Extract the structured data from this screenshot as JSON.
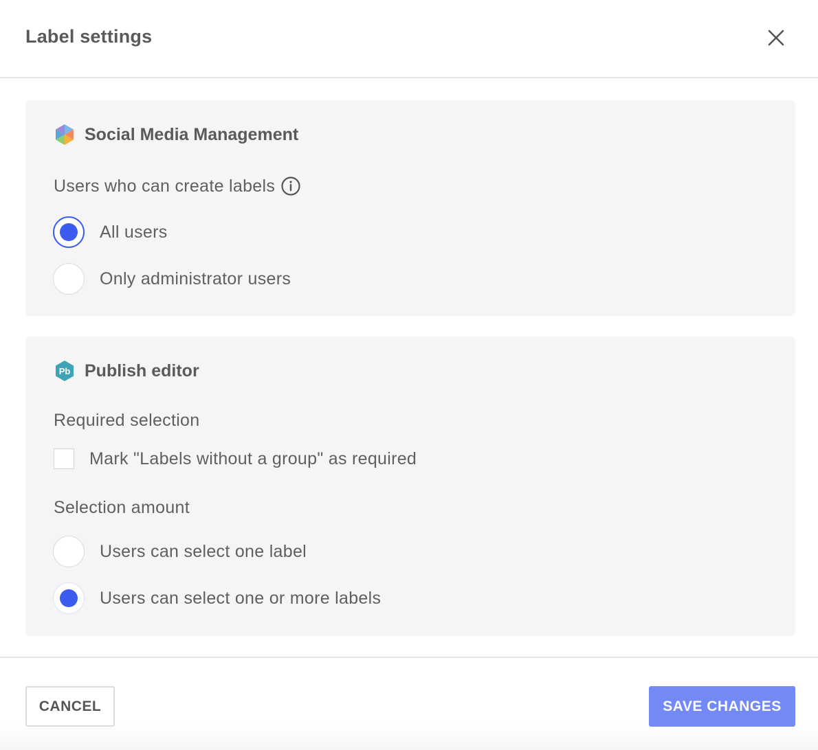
{
  "dialog": {
    "title": "Label settings",
    "close_icon": "close-icon"
  },
  "social_media": {
    "title": "Social Media Management",
    "icon": "social-media-management-logo-icon",
    "users_label": "Users who can create labels",
    "info_icon": "info-icon",
    "options": [
      {
        "label": "All users",
        "selected": true
      },
      {
        "label": "Only administrator users",
        "selected": false
      }
    ]
  },
  "publish_editor": {
    "title": "Publish editor",
    "icon": "publish-editor-logo-icon",
    "logo_text": "Pb",
    "required_label": "Required selection",
    "required_checkbox": {
      "label": "Mark \"Labels without a group\" as required",
      "checked": false
    },
    "amount_label": "Selection amount",
    "options": [
      {
        "label": "Users can select one label",
        "selected": false
      },
      {
        "label": "Users can select one or more labels",
        "selected": true
      }
    ]
  },
  "footer": {
    "cancel_label": "CANCEL",
    "save_label": "SAVE CHANGES"
  },
  "colors": {
    "accent": "#3c5cf0",
    "save_button": "#7289f6",
    "card_background": "#f5f5f5"
  }
}
